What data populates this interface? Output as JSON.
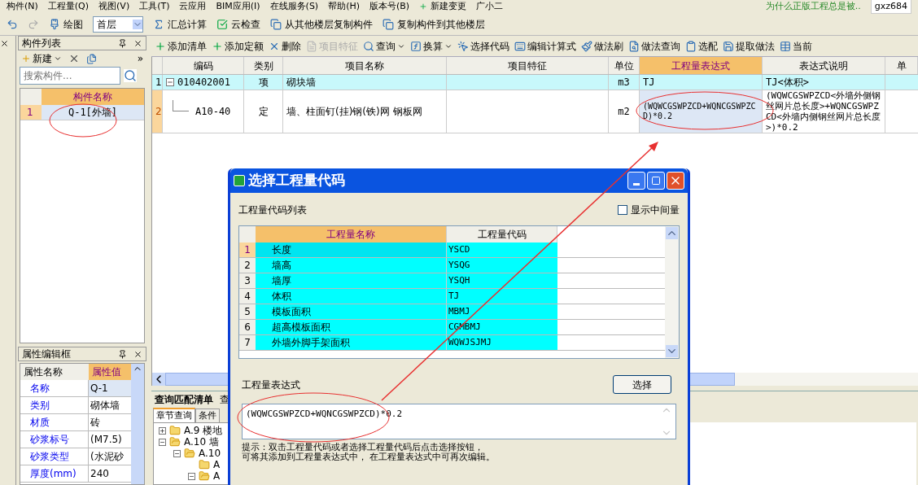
{
  "menu": [
    "构件(N)",
    "工程量(Q)",
    "视图(V)",
    "工具(T)",
    "云应用",
    "BIM应用(I)",
    "在线服务(S)",
    "帮助(H)",
    "版本号(B)"
  ],
  "menu_extras": {
    "new_change": "新建变更",
    "assistant": "广小二",
    "news": "为什么正版工程总是被..",
    "account": "gxz684"
  },
  "toolbar": {
    "draw_label": "绘图",
    "floor": "首层",
    "buttons": [
      "汇总计算",
      "云检查",
      "从其他楼层复制构件",
      "复制构件到其他楼层"
    ]
  },
  "component_list": {
    "title": "构件列表",
    "new_button": "新建",
    "more": "»",
    "search_placeholder": "搜索构件...",
    "column": "构件名称",
    "rows": [
      {
        "index": "1",
        "name": "Q-1[外墙]",
        "selected": true
      }
    ]
  },
  "properties": {
    "title": "属性编辑框",
    "columns": [
      "属性名称",
      "属性值"
    ],
    "rows": [
      {
        "name": "名称",
        "value": "Q-1",
        "selected": true
      },
      {
        "name": "类别",
        "value": "砌体墙",
        "selected": false
      },
      {
        "name": "材质",
        "value": "砖",
        "selected": false
      },
      {
        "name": "砂浆标号",
        "value": "(M7.5)",
        "selected": false
      },
      {
        "name": "砂浆类型",
        "value": "(水泥砂",
        "selected": false
      },
      {
        "name": "厚度(mm)",
        "value": "240",
        "selected": false
      }
    ]
  },
  "item_toolbar": [
    {
      "label": "添加清单",
      "disabled": false,
      "dropdown": false
    },
    {
      "label": "添加定额",
      "disabled": false,
      "dropdown": false
    },
    {
      "label": "删除",
      "disabled": false,
      "dropdown": false
    },
    {
      "label": "项目特征",
      "disabled": true,
      "dropdown": false
    },
    {
      "label": "查询",
      "disabled": false,
      "dropdown": true
    },
    {
      "label": "换算",
      "disabled": false,
      "dropdown": true
    },
    {
      "label": "选择代码",
      "disabled": false,
      "dropdown": false
    },
    {
      "label": "编辑计算式",
      "disabled": false,
      "dropdown": false
    },
    {
      "label": "做法刷",
      "disabled": false,
      "dropdown": false
    },
    {
      "label": "做法查询",
      "disabled": false,
      "dropdown": false
    },
    {
      "label": "选配",
      "disabled": false,
      "dropdown": false
    },
    {
      "label": "提取做法",
      "disabled": false,
      "dropdown": false
    },
    {
      "label": "当前",
      "disabled": false,
      "dropdown": false
    }
  ],
  "grid": {
    "columns": [
      {
        "label": "编码",
        "selected": false
      },
      {
        "label": "类别",
        "selected": false
      },
      {
        "label": "项目名称",
        "selected": false
      },
      {
        "label": "项目特征",
        "selected": false
      },
      {
        "label": "单位",
        "selected": false
      },
      {
        "label": "工程量表达式",
        "selected": true
      },
      {
        "label": "表达式说明",
        "selected": false
      },
      {
        "label": "单",
        "selected": false
      }
    ],
    "rows": [
      {
        "index": "1",
        "kind": "list",
        "expanded": true,
        "code": "010402001",
        "type": "项",
        "name": "砌块墙",
        "unit": "m3",
        "expression": "TJ",
        "explanation": "TJ<体积>"
      },
      {
        "index": "2",
        "kind": "quota",
        "code": "A10-40",
        "type": "定",
        "name": "墙、柱面钉(挂)钢(铁)网 钢板网",
        "unit": "m2",
        "expression": "(WQWCGSWPZCD+WQNCGSWPZCD)*0.2",
        "explanation": "(WQWCGSWPZCD<外墙外侧钢丝网片总长度>+WQNCGSWPZCD<外墙内侧钢丝网片总长度>)*0.2"
      }
    ]
  },
  "lower_panel": {
    "tabs": [
      {
        "label": "查询匹配清单",
        "selected": true
      },
      {
        "label": "查",
        "selected": false
      }
    ],
    "sub_tabs": [
      {
        "label": "章节查询",
        "selected": true
      },
      {
        "label": "条件",
        "selected": false
      }
    ],
    "tree": [
      {
        "label": "A.9 楼地",
        "expanded": false
      },
      {
        "label": "A.10 墙",
        "expanded": true,
        "children": [
          {
            "label": "A.10",
            "expanded": true,
            "children": [
              {
                "label": "A"
              },
              {
                "label": "A",
                "expanded": true
              }
            ]
          }
        ]
      }
    ]
  },
  "dialog": {
    "title": "选择工程量代码",
    "list_label": "工程量代码列表",
    "show_intermediate": {
      "label": "显示中间量",
      "checked": false
    },
    "columns": [
      {
        "label": "工程量名称",
        "selected": true
      },
      {
        "label": "工程量代码",
        "selected": false
      }
    ],
    "rows": [
      {
        "index": "1",
        "name": "长度",
        "code": "YSCD",
        "selected": true
      },
      {
        "index": "2",
        "name": "墙高",
        "code": "YSQG",
        "selected": false
      },
      {
        "index": "3",
        "name": "墙厚",
        "code": "YSQH",
        "selected": false
      },
      {
        "index": "4",
        "name": "体积",
        "code": "TJ",
        "selected": false
      },
      {
        "index": "5",
        "name": "模板面积",
        "code": "MBMJ",
        "selected": false
      },
      {
        "index": "6",
        "name": "超高模板面积",
        "code": "CGMBMJ",
        "selected": false
      },
      {
        "index": "7",
        "name": "外墙外脚手架面积",
        "code": "WQWJSJMJ",
        "selected": false
      }
    ],
    "expression_label": "工程量表达式",
    "select_button": "选择",
    "expression": "(WQWCGSWPZCD+WQNCGSWPZCD)*0.2",
    "hint": [
      "提示：双击工程量代码或者选择工程量代码后点击选择按钮，",
      "可将其添加到工程量表达式中， 在工程量表达式中可再次编辑。"
    ]
  }
}
